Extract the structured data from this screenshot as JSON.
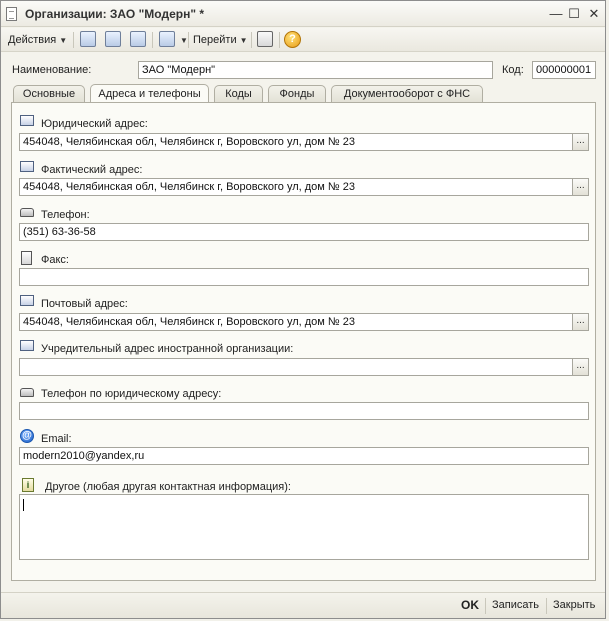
{
  "window": {
    "title": "Организации: ЗАО \"Модерн\" *",
    "minimize": "—",
    "maximize": "☐",
    "close": "✕"
  },
  "toolbar": {
    "actions_label": "Действия",
    "goto_label": "Перейти",
    "help_symbol": "?"
  },
  "header": {
    "name_label": "Наименование:",
    "name_value": "ЗАО \"Модерн\"",
    "code_label": "Код:",
    "code_value": "000000001"
  },
  "tabs": [
    {
      "label": "Основные"
    },
    {
      "label": "Адреса и телефоны"
    },
    {
      "label": "Коды"
    },
    {
      "label": "Фонды"
    },
    {
      "label": "Документооборот с ФНС"
    }
  ],
  "contacts": {
    "legal_address_label": "Юридический адрес:",
    "legal_address_value": "454048, Челябинская обл, Челябинск г, Воровского ул, дом № 23",
    "actual_address_label": "Фактический адрес:",
    "actual_address_value": "454048, Челябинская обл, Челябинск г, Воровского ул, дом № 23",
    "phone_label": "Телефон:",
    "phone_value": "(351) 63-36-58",
    "fax_label": "Факс:",
    "fax_value": "",
    "postal_address_label": "Почтовый адрес:",
    "postal_address_value": "454048, Челябинская обл, Челябинск г, Воровского ул, дом № 23",
    "foreign_address_label": "Учредительный адрес иностранной организации:",
    "foreign_address_value": "",
    "legal_phone_label": "Телефон по юридическому адресу:",
    "legal_phone_value": "",
    "email_label": "Email:",
    "email_value": "modern2010@yandex,ru",
    "email_icon_glyph": "@",
    "other_label": "Другое (любая другая контактная информация):",
    "other_icon_glyph": "i",
    "other_value": "",
    "dots": "..."
  },
  "footer": {
    "ok_label": "OK",
    "save_label": "Записать",
    "close_label": "Закрыть"
  }
}
